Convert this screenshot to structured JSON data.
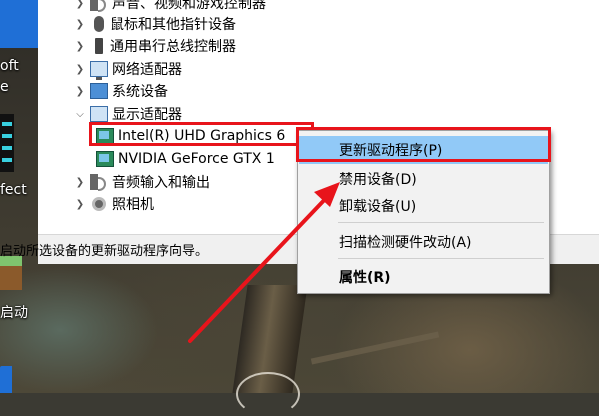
{
  "desktop": {
    "icon_texts": [
      "oft",
      "e",
      "fect",
      "启动"
    ]
  },
  "device_manager": {
    "tree_items": [
      {
        "label": "声音、视频和游戏控制器",
        "icon": "speaker-icon",
        "expanded": false
      },
      {
        "label": "鼠标和其他指针设备",
        "icon": "mouse-icon",
        "expanded": false
      },
      {
        "label": "通用串行总线控制器",
        "icon": "usb-icon",
        "expanded": false
      },
      {
        "label": "网络适配器",
        "icon": "network-adapter-icon",
        "expanded": false
      },
      {
        "label": "系统设备",
        "icon": "system-device-icon",
        "expanded": false
      },
      {
        "label": "显示适配器",
        "icon": "display-adapter-icon",
        "expanded": true
      },
      {
        "label": "Intel(R) UHD Graphics 6",
        "icon": "gpu-icon",
        "child": true,
        "selected": true
      },
      {
        "label": "NVIDIA GeForce GTX 1",
        "icon": "gpu-icon",
        "child": true
      },
      {
        "label": "音频输入和输出",
        "icon": "audio-io-icon",
        "expanded": false
      },
      {
        "label": "照相机",
        "icon": "camera-icon",
        "expanded": false
      }
    ],
    "status_text": "启动所选设备的更新驱动程序向导。"
  },
  "context_menu": {
    "items": {
      "update_driver": "更新驱动程序(P)",
      "disable_device": "禁用设备(D)",
      "uninstall_device": "卸载设备(U)",
      "scan_hardware": "扫描检测硬件改动(A)",
      "properties": "属性(R)"
    }
  },
  "colors": {
    "annotation_red": "#e8141b",
    "menu_highlight": "#91c9f7",
    "status_bar": "#f0f0f0"
  }
}
